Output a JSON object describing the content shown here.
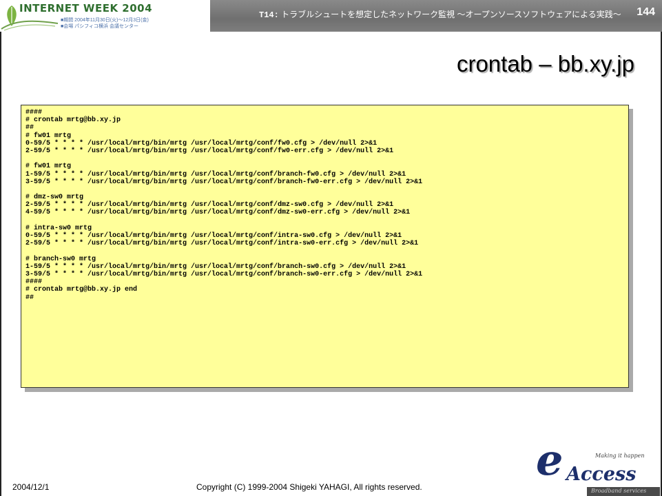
{
  "header": {
    "logo_text": "INTERNET WEEK 2004",
    "logo_line1": "■期間 2004年11月30日(火)～12月3日(金)",
    "logo_line2": "■会場 パシフィコ横浜 会議センター",
    "session_code": "T14:",
    "session_title": " トラブルシュートを想定したネットワーク監視 ～オープンソースソフトウェアによる実践～",
    "page_number": "144"
  },
  "slide_title": "crontab – bb.xy.jp",
  "code_lines": [
    "####",
    "# crontab mrtg@bb.xy.jp",
    "##",
    "# fw01 mrtg",
    "0-59/5 * * * * /usr/local/mrtg/bin/mrtg /usr/local/mrtg/conf/fw0.cfg > /dev/null 2>&1",
    "2-59/5 * * * * /usr/local/mrtg/bin/mrtg /usr/local/mrtg/conf/fw0-err.cfg > /dev/null 2>&1",
    "",
    "# fw01 mrtg",
    "1-59/5 * * * * /usr/local/mrtg/bin/mrtg /usr/local/mrtg/conf/branch-fw0.cfg > /dev/null 2>&1",
    "3-59/5 * * * * /usr/local/mrtg/bin/mrtg /usr/local/mrtg/conf/branch-fw0-err.cfg > /dev/null 2>&1",
    "",
    "# dmz-sw0 mrtg",
    "2-59/5 * * * * /usr/local/mrtg/bin/mrtg /usr/local/mrtg/conf/dmz-sw0.cfg > /dev/null 2>&1",
    "4-59/5 * * * * /usr/local/mrtg/bin/mrtg /usr/local/mrtg/conf/dmz-sw0-err.cfg > /dev/null 2>&1",
    "",
    "# intra-sw0 mrtg",
    "0-59/5 * * * * /usr/local/mrtg/bin/mrtg /usr/local/mrtg/conf/intra-sw0.cfg > /dev/null 2>&1",
    "2-59/5 * * * * /usr/local/mrtg/bin/mrtg /usr/local/mrtg/conf/intra-sw0-err.cfg > /dev/null 2>&1",
    "",
    "# branch-sw0 mrtg",
    "1-59/5 * * * * /usr/local/mrtg/bin/mrtg /usr/local/mrtg/conf/branch-sw0.cfg > /dev/null 2>&1",
    "3-59/5 * * * * /usr/local/mrtg/bin/mrtg /usr/local/mrtg/conf/branch-sw0-err.cfg > /dev/null 2>&1",
    "####",
    "# crontab mrtg@bb.xy.jp end",
    "##"
  ],
  "footer": {
    "date": "2004/12/1",
    "copyright": "Copyright (C) 1999-2004 Shigeki YAHAGI, All rights reserved."
  },
  "brand_logo": {
    "letter": "e",
    "name": "Access",
    "tagline": "Making it happen",
    "subtitle": "Broadband services"
  },
  "colors": {
    "header_band": "#7a7a7a",
    "code_background": "#ffff9a",
    "brand_navy": "#1d2f6b"
  }
}
